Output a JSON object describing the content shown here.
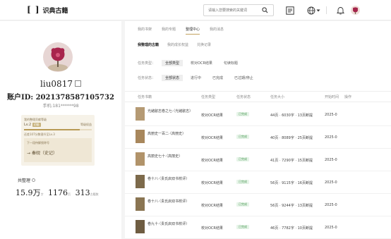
{
  "topbar": {
    "logo_mark": "[ ]",
    "logo_text": "识典古籍",
    "search_placeholder": "请输入您要搜索的关键词",
    "search_icon": "search-icon",
    "toc_icon": "toc-icon",
    "globe_icon": "globe-icon",
    "dropdown_icon": "chevron-down-icon",
    "bell_icon": "bell-icon"
  },
  "profile": {
    "username": "liu0817",
    "account_label": "账户ID:",
    "account_id": "2021378587105732",
    "phone_label": "手机:",
    "phone": "181******98",
    "level_card": {
      "header": "我的整理贡献等级",
      "level": "Lv.2",
      "level_badge": "初级",
      "benefits": "等级权益",
      "progress": 0.82,
      "hint": "还差107分数晋升至Lv.3",
      "next_title": "下一段待解锁称号",
      "next_badge": "秦砚（史记）"
    },
    "gongzheng_label": "共整理",
    "stats": [
      {
        "num": "15.9万",
        "unit": "字"
      },
      {
        "num": "1176",
        "unit": "页"
      },
      {
        "num": "313",
        "unit": "古籍数"
      }
    ]
  },
  "main": {
    "tabs": [
      "我的书架",
      "我的专题",
      "整理中心",
      "我的消息"
    ],
    "active_tab": 2,
    "sub_tabs": [
      "我整理的古籍",
      "我的成长权益",
      "兑换记录"
    ],
    "active_sub": 0,
    "filter_type": {
      "label": "任务类型：",
      "options": [
        "全部类型",
        "校对OCR结果",
        "句读标题"
      ],
      "active": 0
    },
    "filter_status": {
      "label": "任务状态：",
      "options": [
        "全部状态",
        "进行中",
        "已完成",
        "已过期/停止"
      ],
      "active": 0
    },
    "columns": [
      "任务书籍",
      "任务类型",
      "任务状态",
      "任务大小",
      "开始时间",
      "操作"
    ],
    "rows": [
      {
        "name": "光緒歙志卷之七·（光緒歙志）",
        "type": "校对OCR结果",
        "status": "已完成",
        "size": "44页 · 6030字 · 13页断提",
        "time": "2025-0",
        "cover": "#b59a74"
      },
      {
        "name": "高丽史一百二·（高丽史）",
        "type": "校对OCR结果",
        "status": "已完成",
        "size": "40页 · 8089字 · 25页断提",
        "time": "2025-0",
        "cover": "#a8875c"
      },
      {
        "name": "高丽史七十·（高丽史）",
        "type": "校对OCR结果",
        "status": "已完成",
        "size": "41页 · 7290字 · 15页断提",
        "time": "2025-0",
        "cover": "#b1936a"
      },
      {
        "name": "卷十八·（贵氏启双书校评）",
        "type": "校对OCR结果",
        "status": "已完成",
        "size": "56页 · 9115字 · 16页断提",
        "time": "2025-0",
        "cover": "#7d6a4b"
      },
      {
        "name": "卷十八·（贵氏启双书校评）",
        "type": "校对OCR结果",
        "status": "已完成",
        "size": "56页 · 9244字 · 13页断提",
        "time": "2025-0",
        "cover": "#8a7552"
      },
      {
        "name": "卷九十·（贵氏启双书校评）",
        "type": "校对OCR结果",
        "status": "已完成",
        "size": "46页 · 7782字 · 10页断提",
        "time": "2025-0",
        "cover": "#6f5d42"
      }
    ]
  }
}
